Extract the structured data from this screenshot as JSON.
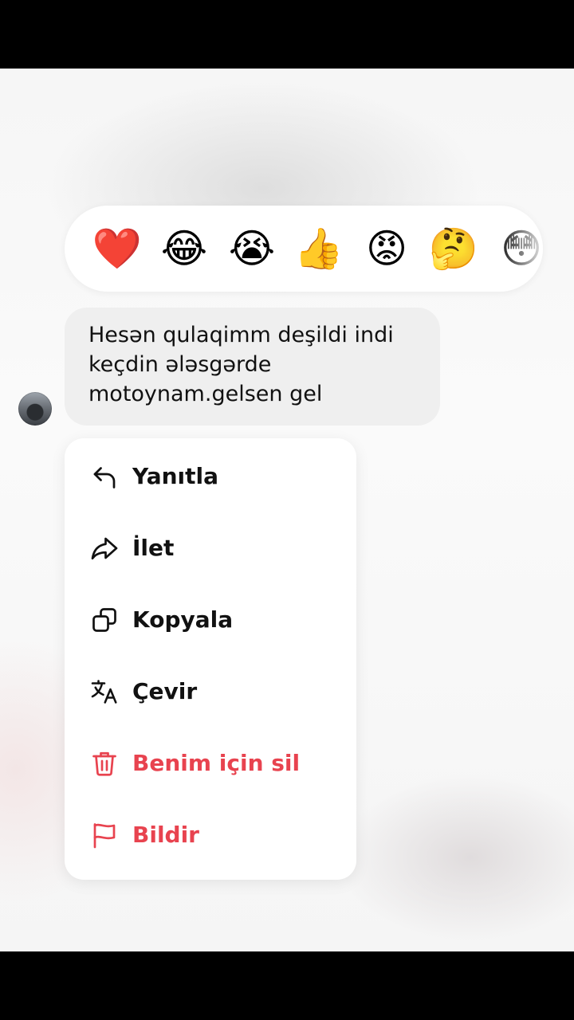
{
  "reactions": [
    {
      "emoji": "❤️",
      "name": "red-heart"
    },
    {
      "emoji": "😂",
      "name": "tears-of-joy"
    },
    {
      "emoji": "😭",
      "name": "loudly-crying"
    },
    {
      "emoji": "👍",
      "name": "thumbs-up"
    },
    {
      "emoji": "😡",
      "name": "angry-face"
    },
    {
      "emoji": "🤔",
      "name": "thinking-face"
    },
    {
      "emoji": "😳",
      "name": "flushed-face"
    }
  ],
  "message": {
    "lines": [
      "Hesən qulaqimm deşildi indi",
      "keçdin ələsgərde",
      "motoynam.gelsen gel"
    ]
  },
  "menu": {
    "items": [
      {
        "label": "Yanıtla",
        "icon": "reply-icon"
      },
      {
        "label": "İlet",
        "icon": "forward-icon"
      },
      {
        "label": "Kopyala",
        "icon": "copy-icon"
      },
      {
        "label": "Çevir",
        "icon": "translate-icon"
      },
      {
        "label": "Benim için sil",
        "icon": "trash-icon"
      },
      {
        "label": "Bildir",
        "icon": "flag-icon"
      }
    ],
    "danger_color": "#e8434f",
    "text_color": "#111111"
  }
}
